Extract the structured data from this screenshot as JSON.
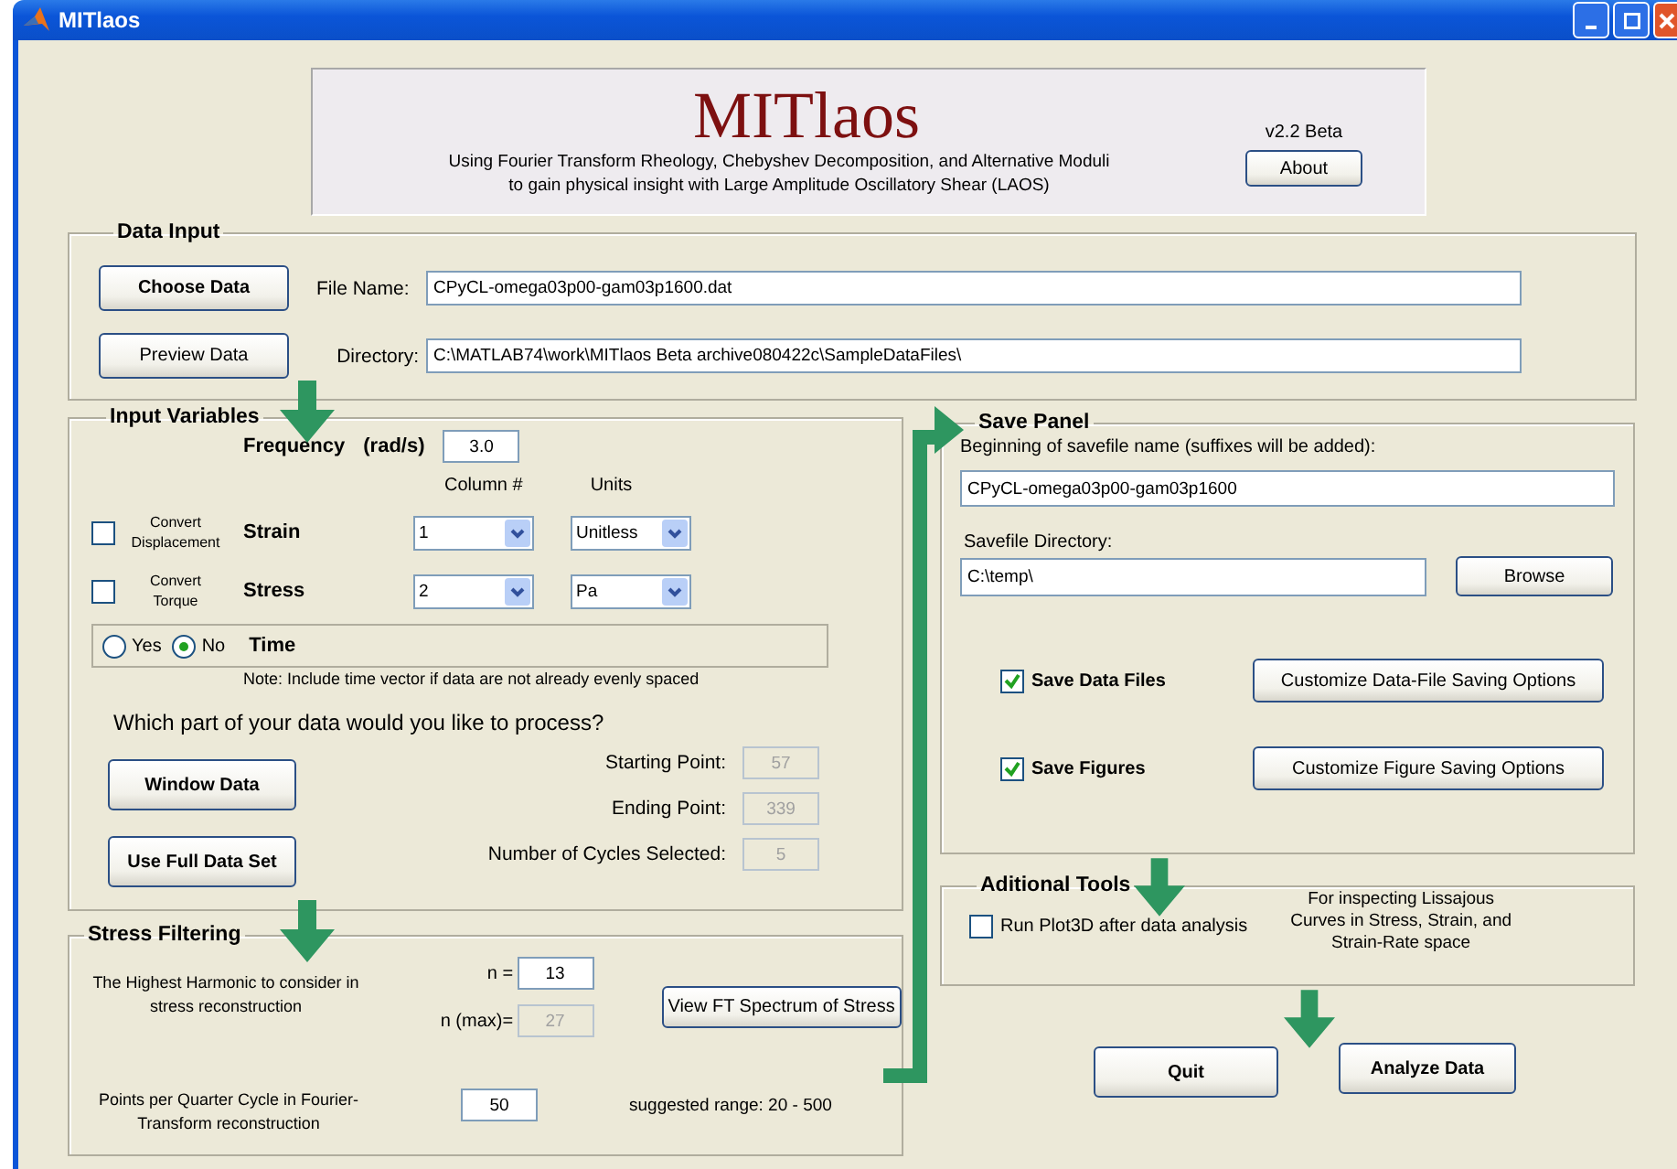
{
  "window": {
    "title": "MITlaos"
  },
  "header": {
    "title": "MITlaos",
    "subtitle": [
      "Using Fourier Transform Rheology, Chebyshev Decomposition, and Alternative Moduli",
      "to gain physical insight with Large Amplitude Oscillatory Shear (LAOS)"
    ],
    "version": "v2.2 Beta",
    "about_button": "About"
  },
  "data_input": {
    "legend": "Data Input",
    "choose_button": "Choose Data",
    "preview_button": "Preview Data",
    "file_name_label": "File Name:",
    "file_name_value": "CPyCL-omega03p00-gam03p1600.dat",
    "directory_label": "Directory:",
    "directory_value": "C:\\MATLAB74\\work\\MITlaos Beta archive080422c\\SampleDataFiles\\"
  },
  "input_variables": {
    "legend": "Input Variables",
    "frequency_label": "Frequency",
    "frequency_unit": "(rad/s)",
    "frequency_value": "3.0",
    "column_header": "Column #",
    "units_header": "Units",
    "rows": [
      {
        "convert_label": "Convert Displacement",
        "checked": false,
        "name": "Strain",
        "column": "1",
        "units": "Unitless"
      },
      {
        "convert_label": "Convert Torque",
        "checked": false,
        "name": "Stress",
        "column": "2",
        "units": "Pa"
      }
    ],
    "time": {
      "options": [
        {
          "label": "Yes",
          "selected": false
        },
        {
          "label": "No",
          "selected": true
        }
      ],
      "label": "Time"
    },
    "note": "Note: Include time vector if data are not already evenly spaced",
    "question": "Which part of your data would you like to process?",
    "window_button": "Window Data",
    "full_button": "Use Full Data Set",
    "fields": [
      {
        "label": "Starting Point:",
        "value": "57",
        "disabled": true
      },
      {
        "label": "Ending Point:",
        "value": "339",
        "disabled": true
      },
      {
        "label": "Number of Cycles Selected:",
        "value": "5",
        "disabled": true
      }
    ]
  },
  "stress_filtering": {
    "legend": "Stress Filtering",
    "harmonic_label": "The Highest Harmonic to consider in stress reconstruction",
    "n_label": "n =",
    "n_value": "13",
    "n_disabled": false,
    "nmax_label": "n (max)=",
    "nmax_value": "27",
    "nmax_disabled": true,
    "spectrum_button": "View FT Spectrum of Stress",
    "points_label": "Points per Quarter Cycle in Fourier-Transform reconstruction",
    "points_value": "50",
    "range_note": "suggested range: 20 - 500"
  },
  "save_panel": {
    "legend": "Save Panel",
    "name_label": "Beginning of savefile name (suffixes will be added):",
    "name_value": "CPyCL-omega03p00-gam03p1600",
    "dir_label": "Savefile Directory:",
    "dir_value": "C:\\temp\\",
    "browse_button": "Browse",
    "options": [
      {
        "label": "Save Data Files",
        "checked": true,
        "button": "Customize Data-File Saving Options"
      },
      {
        "label": "Save Figures",
        "checked": true,
        "button": "Customize Figure Saving Options"
      }
    ]
  },
  "additional_tools": {
    "legend": "Aditional Tools",
    "run_plot3d": {
      "label": "Run Plot3D after data analysis",
      "checked": false
    },
    "note": "For inspecting Lissajous Curves in  Stress, Strain, and Strain-Rate space"
  },
  "buttons": [
    "Quit",
    "Analyze Data"
  ]
}
